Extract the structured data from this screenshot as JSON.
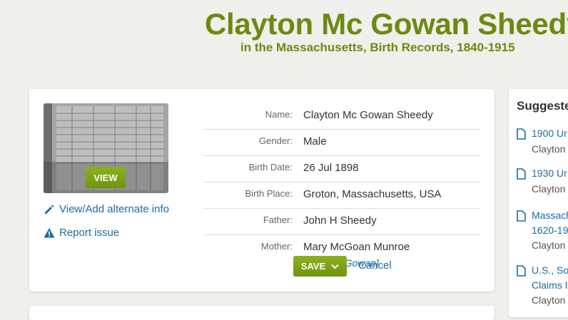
{
  "header": {
    "title": "Clayton Mc Gowan Sheedy",
    "subtitle": "in the Massachusetts, Birth Records, 1840-1915"
  },
  "record": {
    "view_label": "VIEW",
    "view_alt_label": "View/Add alternate info",
    "report_label": "Report issue",
    "fields": [
      {
        "label": "Name:",
        "value": "Clayton Mc Gowan Sheedy"
      },
      {
        "label": "Gender:",
        "value": "Male"
      },
      {
        "label": "Birth Date:",
        "value": "26 Jul 1898"
      },
      {
        "label": "Birth Place:",
        "value": "Groton, Massachusetts, USA"
      },
      {
        "label": "Father:",
        "value": "John H Sheedy"
      },
      {
        "label": "Mother:",
        "value": "Mary McGoan Munroe",
        "alternate": "[Mary McGowan]"
      }
    ],
    "save_label": "SAVE",
    "cancel_label": "Cancel"
  },
  "suggested": {
    "title": "Suggeste",
    "items": [
      {
        "line1": "1900 Ur",
        "line2": "",
        "name": "Clayton"
      },
      {
        "line1": "1930 Ur",
        "line2": "",
        "name": "Clayton"
      },
      {
        "line1": "Massach",
        "line2": "1620-19",
        "name": "Clayton"
      },
      {
        "line1": "U.S., So",
        "line2": "Claims I",
        "name": "Clayton"
      }
    ]
  },
  "colors": {
    "accent_green": "#6b8a10",
    "link_blue": "#1e6aa0"
  }
}
